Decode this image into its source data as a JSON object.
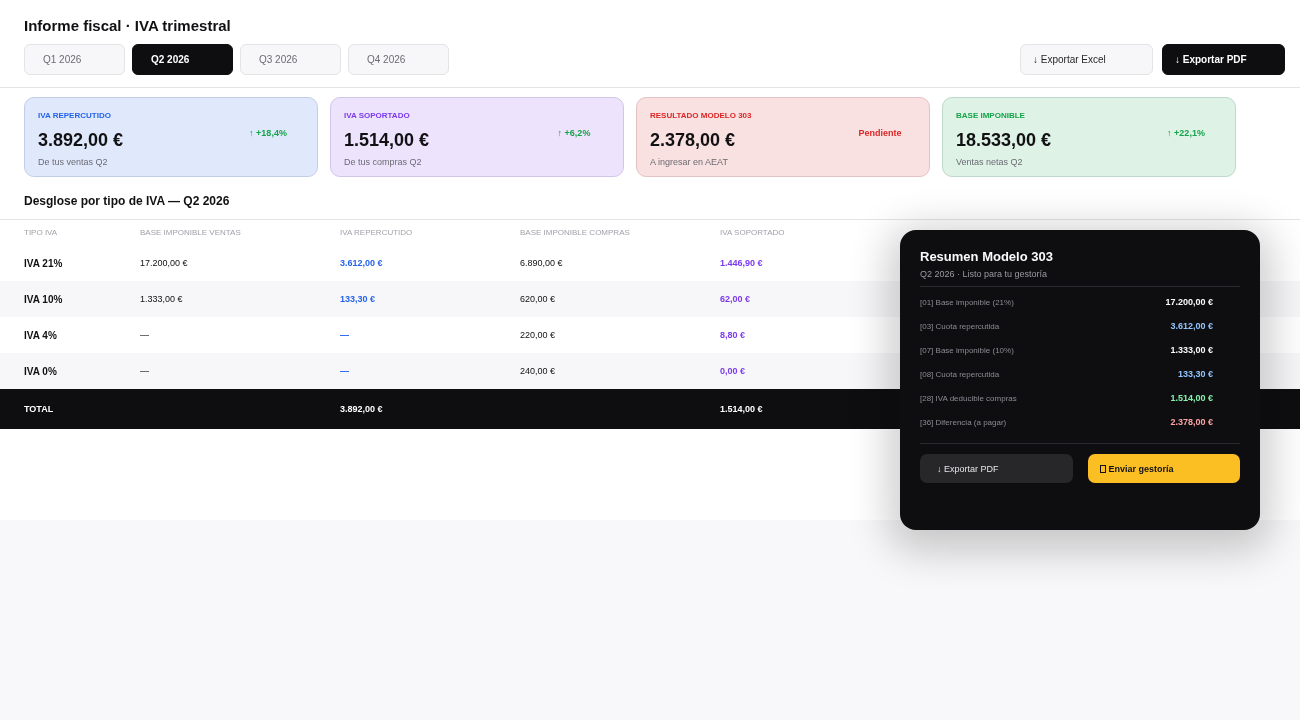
{
  "page": {
    "title": "Informe fiscal · IVA trimestral"
  },
  "tabs": [
    {
      "label": "Q1 2026",
      "selected": false
    },
    {
      "label": "Q2 2026",
      "selected": true
    },
    {
      "label": "Q3 2026",
      "selected": false
    },
    {
      "label": "Q4 2026",
      "selected": false
    }
  ],
  "actions": [
    {
      "label": "↓ Exportar Excel",
      "kind": "secondary"
    },
    {
      "label": "↓ Exportar PDF",
      "kind": "primary"
    }
  ],
  "cards": [
    {
      "label": "IVA REPERCUTIDO",
      "value": "3.892,00 €",
      "note": "De tus ventas Q2",
      "trend": "↑ +18,4%",
      "color": "#2563eb"
    },
    {
      "label": "IVA SOPORTADO",
      "value": "1.514,00 €",
      "note": "De tus compras Q2",
      "trend": "↑ +6,2%",
      "color": "#7c3aed"
    },
    {
      "label": "RESULTADO MODELO 303",
      "value": "2.378,00 €",
      "note": "A ingresar en AEAT",
      "status": "Pendiente",
      "color": "#dc2626"
    },
    {
      "label": "BASE IMPONIBLE",
      "value": "18.533,00 €",
      "note": "Ventas netas Q2",
      "trend": "↑ +22,1%",
      "color": "#16a34a"
    }
  ],
  "breakdown": {
    "title": "Desglose por tipo de IVA — Q2 2026",
    "columns": [
      "TIPO IVA",
      "BASE IMPONIBLE VENTAS",
      "IVA REPERCUTIDO",
      "BASE IMPONIBLE COMPRAS",
      "IVA SOPORTADO"
    ],
    "rows": [
      [
        "IVA 21%",
        "17.200,00 €",
        "3.612,00 €",
        "6.890,00 €",
        "1.446,90 €"
      ],
      [
        "IVA 10%",
        "1.333,00 €",
        "133,30 €",
        "620,00 €",
        "62,00 €"
      ],
      [
        "IVA 4%",
        "—",
        "—",
        "220,00 €",
        "8,80 €"
      ],
      [
        "IVA 0%",
        "—",
        "—",
        "240,00 €",
        "0,00 €"
      ]
    ],
    "total": {
      "label": "TOTAL",
      "iva_repercutido": "3.892,00 €",
      "iva_soportado": "1.514,00 €"
    }
  },
  "summary": {
    "title": "Resumen Modelo 303",
    "subtitle": "Q2 2026 · Listo para tu gestoría",
    "lines": [
      {
        "label": "[01] Base imponible (21%)",
        "value": "17.200,00 €",
        "color": "#fafafa"
      },
      {
        "label": "[03] Cuota repercutida",
        "value": "3.612,00 €",
        "color": "#93c5fd"
      },
      {
        "label": "[07] Base imponible (10%)",
        "value": "1.333,00 €",
        "color": "#fafafa"
      },
      {
        "label": "[08] Cuota repercutida",
        "value": "133,30 €",
        "color": "#93c5fd"
      },
      {
        "label": "[28] IVA deducible compras",
        "value": "1.514,00 €",
        "color": "#86efac"
      },
      {
        "label": "[36] Diferencia (a pagar)",
        "value": "2.378,00 €",
        "color": "#fca5a5"
      }
    ],
    "buttons": [
      {
        "label": "↓ Exportar PDF",
        "kind": "secondary"
      },
      {
        "label": "Enviar gestoría",
        "kind": "primary"
      }
    ]
  }
}
